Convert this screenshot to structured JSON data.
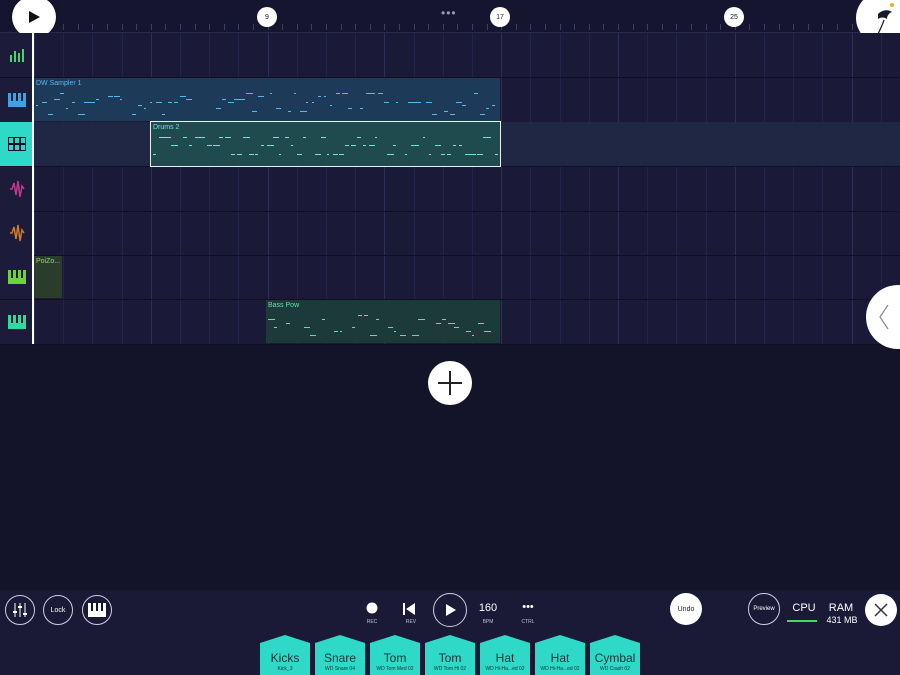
{
  "timeline": {
    "bar_markers": [
      "9",
      "17",
      "25"
    ],
    "handle": "•••"
  },
  "tracks": [
    {
      "icon": "mixer-bars-icon",
      "color": "#4fd26b"
    },
    {
      "icon": "piano-keys-icon",
      "color": "#3aa3e8"
    },
    {
      "icon": "drum-pads-icon",
      "color": "#2fd9c7",
      "selected": true
    },
    {
      "icon": "waveform-icon",
      "color": "#c2378f"
    },
    {
      "icon": "waveform-icon",
      "color": "#d07a2a"
    },
    {
      "icon": "piano-keys-icon",
      "color": "#6dd436"
    },
    {
      "icon": "piano-keys-icon",
      "color": "#2fd9a0"
    }
  ],
  "clips": {
    "dw_sampler": "DW Sampler 1",
    "drums": "Drums 2",
    "poizo": "PoiZo...",
    "bass": "Bass Pow"
  },
  "toolbar": {
    "lock": "Lock",
    "rec": "REC",
    "rev": "REV",
    "bpm_value": "160",
    "bpm_label": "BPM",
    "ctrl_label": "CTRL",
    "ctrl_icon": "•••",
    "undo": "Undo",
    "preview": "Preview",
    "cpu": "CPU",
    "ram": "RAM",
    "ram_value": "431 MB"
  },
  "pads": [
    {
      "name": "Kicks",
      "sub": "Kick_3"
    },
    {
      "name": "Snare",
      "sub": "WD Snare 04"
    },
    {
      "name": "Tom",
      "sub": "WD Tom Med 02"
    },
    {
      "name": "Tom",
      "sub": "WD Tom Hi 02"
    },
    {
      "name": "Hat",
      "sub": "WD Hi-Ha...ed 02"
    },
    {
      "name": "Hat",
      "sub": "WD Hi-Ha...ed 02"
    },
    {
      "name": "Cymbal",
      "sub": "WD Crash 02"
    }
  ],
  "colors": {
    "accent": "#2fd9c7",
    "cpu_meter": "#3ee05a",
    "background": "#13132a"
  }
}
